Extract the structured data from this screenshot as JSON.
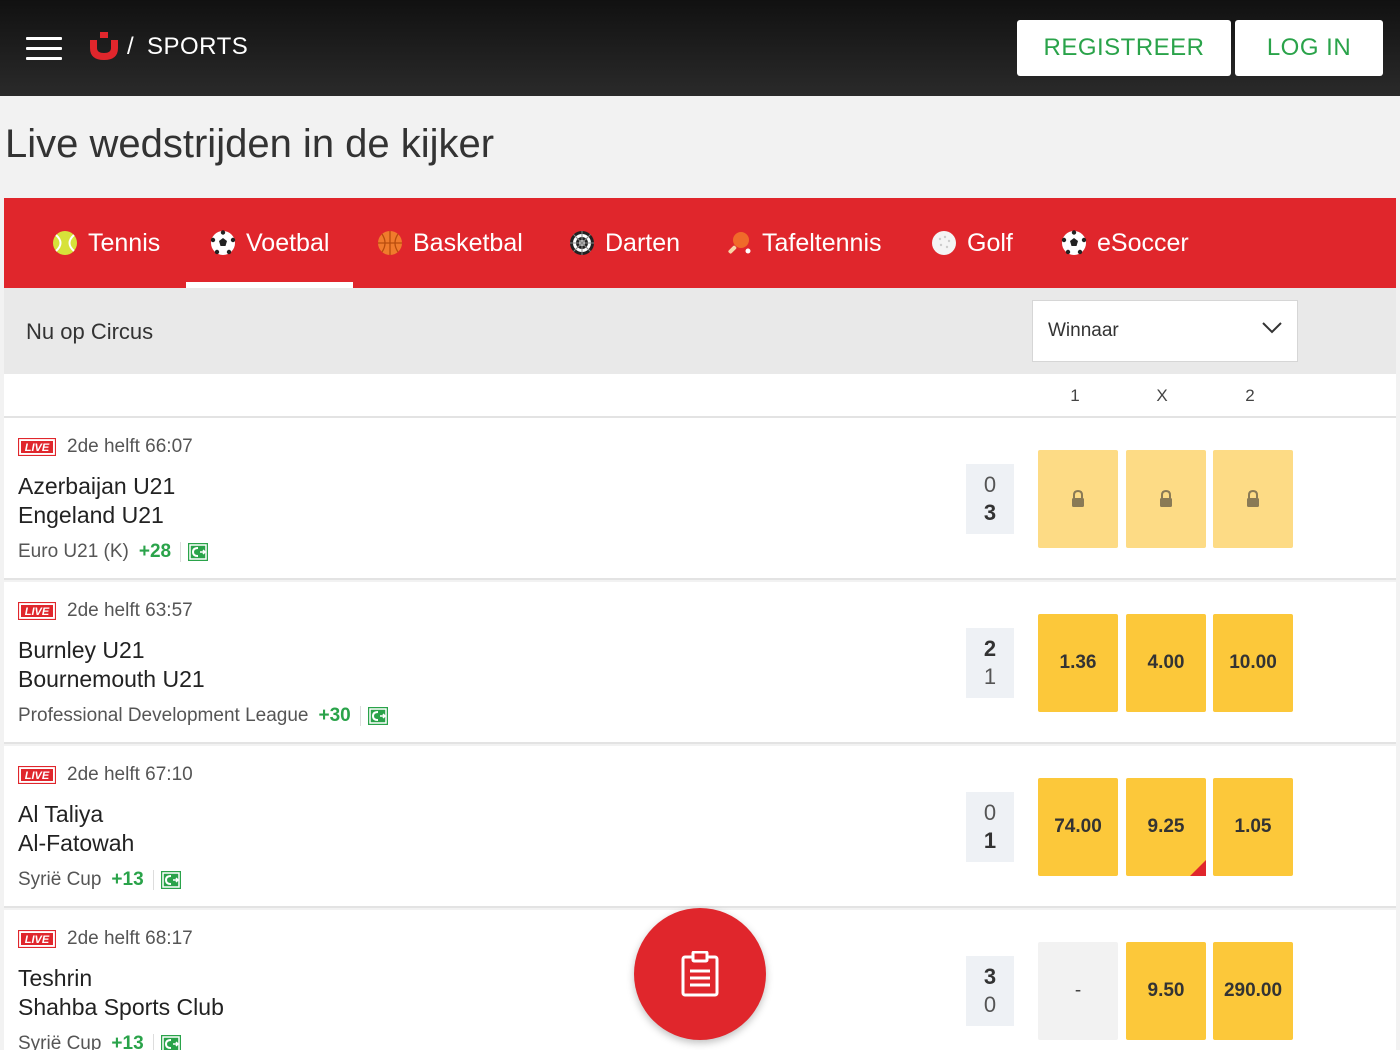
{
  "header": {
    "brand": "SPORTS",
    "register_label": "REGISTREER",
    "login_label": "LOG IN"
  },
  "page_title": "Live wedstrijden in de kijker",
  "sports_tabs": [
    {
      "label": "Tennis",
      "icon": "tennis-ball-icon"
    },
    {
      "label": "Voetbal",
      "icon": "soccer-ball-icon",
      "active": true
    },
    {
      "label": "Basketbal",
      "icon": "basketball-icon"
    },
    {
      "label": "Darten",
      "icon": "dartboard-icon"
    },
    {
      "label": "Tafeltennis",
      "icon": "table-tennis-icon"
    },
    {
      "label": "Golf",
      "icon": "golf-ball-icon"
    },
    {
      "label": "eSoccer",
      "icon": "soccer-ball-icon"
    }
  ],
  "section": {
    "title": "Nu op Circus",
    "market_selected": "Winnaar",
    "columns": [
      "1",
      "X",
      "2"
    ]
  },
  "matches": [
    {
      "status": "2de helft 66:07",
      "home": "Azerbaijan U21",
      "away": "Engeland U21",
      "league": "Euro U21 (K)",
      "more": "+28",
      "score_home": "0",
      "score_away": "3",
      "odds": [
        "locked",
        "locked",
        "locked"
      ]
    },
    {
      "status": "2de helft 63:57",
      "home": "Burnley U21",
      "away": "Bournemouth U21",
      "league": "Professional Development League",
      "more": "+30",
      "score_home": "2",
      "score_away": "1",
      "odds": [
        "1.36",
        "4.00",
        "10.00"
      ]
    },
    {
      "status": "2de helft 67:10",
      "home": "Al Taliya",
      "away": "Al-Fatowah",
      "league": "Syrië Cup",
      "more": "+13",
      "score_home": "0",
      "score_away": "1",
      "odds": [
        "74.00",
        "9.25",
        "1.05"
      ]
    },
    {
      "status": "2de helft 68:17",
      "home": "Teshrin",
      "away": "Shahba Sports Club",
      "league": "Syrië Cup",
      "more": "+13",
      "score_home": "3",
      "score_away": "0",
      "odds": [
        "-",
        "9.50",
        "290.00"
      ]
    }
  ],
  "live_label": "LIVE",
  "colors": {
    "brand_red": "#e0262c",
    "odds_yellow": "#fcc83a",
    "green": "#2aa34a"
  }
}
